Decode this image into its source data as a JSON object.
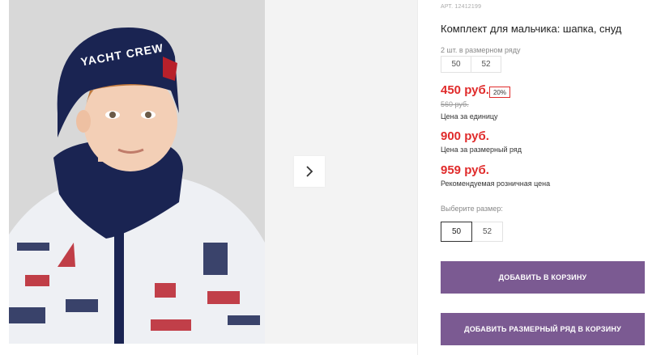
{
  "product": {
    "article": "АРТ. 12412199",
    "title": "Комплект для мальчика: шапка, снуд",
    "set_label": "2 шт. в размерном ряду",
    "set_sizes": [
      "50",
      "52"
    ],
    "price": "450 руб.",
    "discount": "20%",
    "old_price": "560 руб.",
    "unit_note": "Цена за единицу",
    "set_price": "900 руб.",
    "set_note": "Цена за размерный ряд",
    "retail_price": "959 руб.",
    "retail_note": "Рекомендуемая розничная цена",
    "choose_size_label": "Выберите размер:",
    "sizes": [
      "50",
      "52"
    ],
    "selected_size": "50",
    "add_to_cart": "ДОБАВИТЬ В КОРЗИНУ",
    "add_set_to_cart": "ДОБАВИТЬ РАЗМЕРНЫЙ РЯД В КОРЗИНУ"
  },
  "gallery": {
    "hat_print": "YACHT CREW",
    "next_icon": "chevron-right-icon"
  },
  "colors": {
    "price": "#e02b2b",
    "button": "#7b5a92",
    "hat": "#1a2452"
  }
}
